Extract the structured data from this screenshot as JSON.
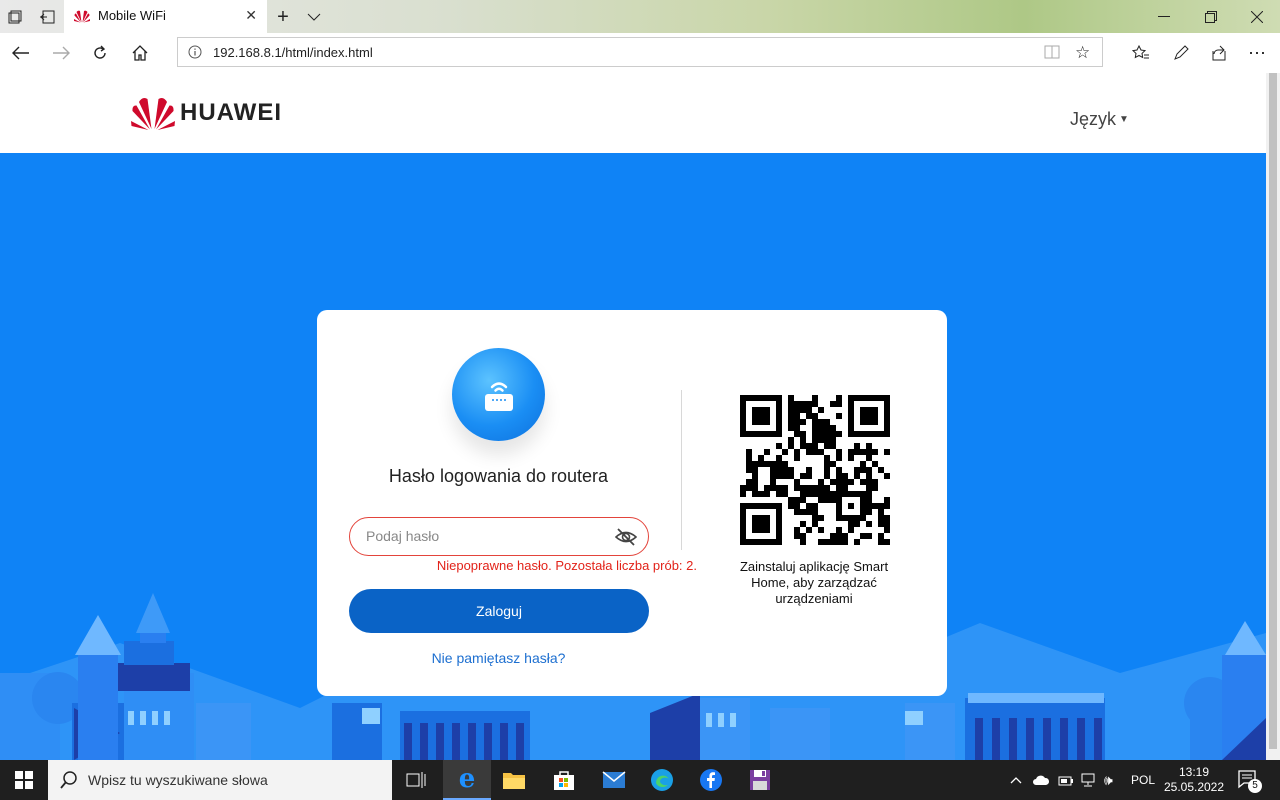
{
  "browser": {
    "tab_title": "Mobile WiFi",
    "url": "192.168.8.1/html/index.html"
  },
  "header": {
    "logo_text": "HUAWEI",
    "language_label": "Język"
  },
  "login": {
    "title": "Hasło logowania do routera",
    "password_placeholder": "Podaj hasło",
    "error_message": "Niepoprawne hasło. Pozostała liczba prób: 2.",
    "login_button": "Zaloguj",
    "forgot_link": "Nie pamiętasz hasła?"
  },
  "qr": {
    "caption": "Zainstaluj aplikację Smart Home, aby zarządzać urządzeniami"
  },
  "taskbar": {
    "search_placeholder": "Wpisz tu wyszukiwane słowa",
    "language": "POL",
    "time": "13:19",
    "date": "25.05.2022",
    "notifications_count": "5"
  },
  "colors": {
    "page_blue": "#0f83f6",
    "button_blue": "#0a63c6",
    "error_red": "#e2231a",
    "huawei_red": "#cf0a2c"
  }
}
